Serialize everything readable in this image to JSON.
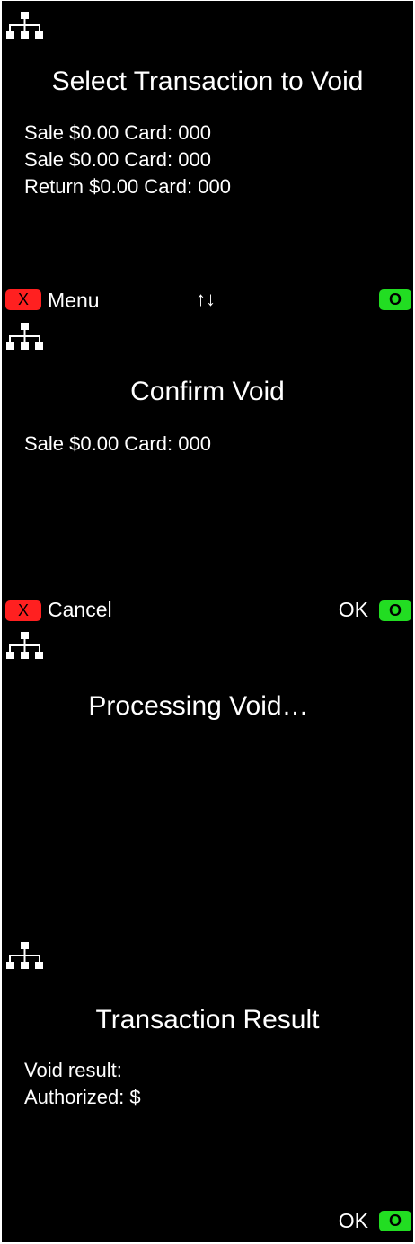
{
  "icons": {
    "network": "network-tree-icon",
    "cancel_key": "red-x-key",
    "confirm_key": "green-o-key"
  },
  "colors": {
    "background": "#000000",
    "text": "#ffffff",
    "cancel_key": "#ff2020",
    "confirm_key": "#22dd22"
  },
  "screens": {
    "select_void": {
      "title": "Select Transaction to Void",
      "items": [
        "Sale $0.00 Card: 000",
        "Sale $0.00 Card: 000",
        "Return $0.00 Card: 000"
      ],
      "cancel_key_label": "X",
      "left_label": "Menu",
      "arrows": "↑↓",
      "confirm_key_label": "O"
    },
    "confirm_void": {
      "title": "Confirm Void",
      "items": [
        "Sale $0.00 Card: 000"
      ],
      "cancel_key_label": "X",
      "left_label": "Cancel",
      "right_label": "OK",
      "confirm_key_label": "O"
    },
    "processing_void": {
      "title": "Processing Void…"
    },
    "transaction_result": {
      "title": "Transaction Result",
      "items": [
        "Void result:",
        "Authorized: $"
      ],
      "right_label": "OK",
      "confirm_key_label": "O"
    }
  }
}
